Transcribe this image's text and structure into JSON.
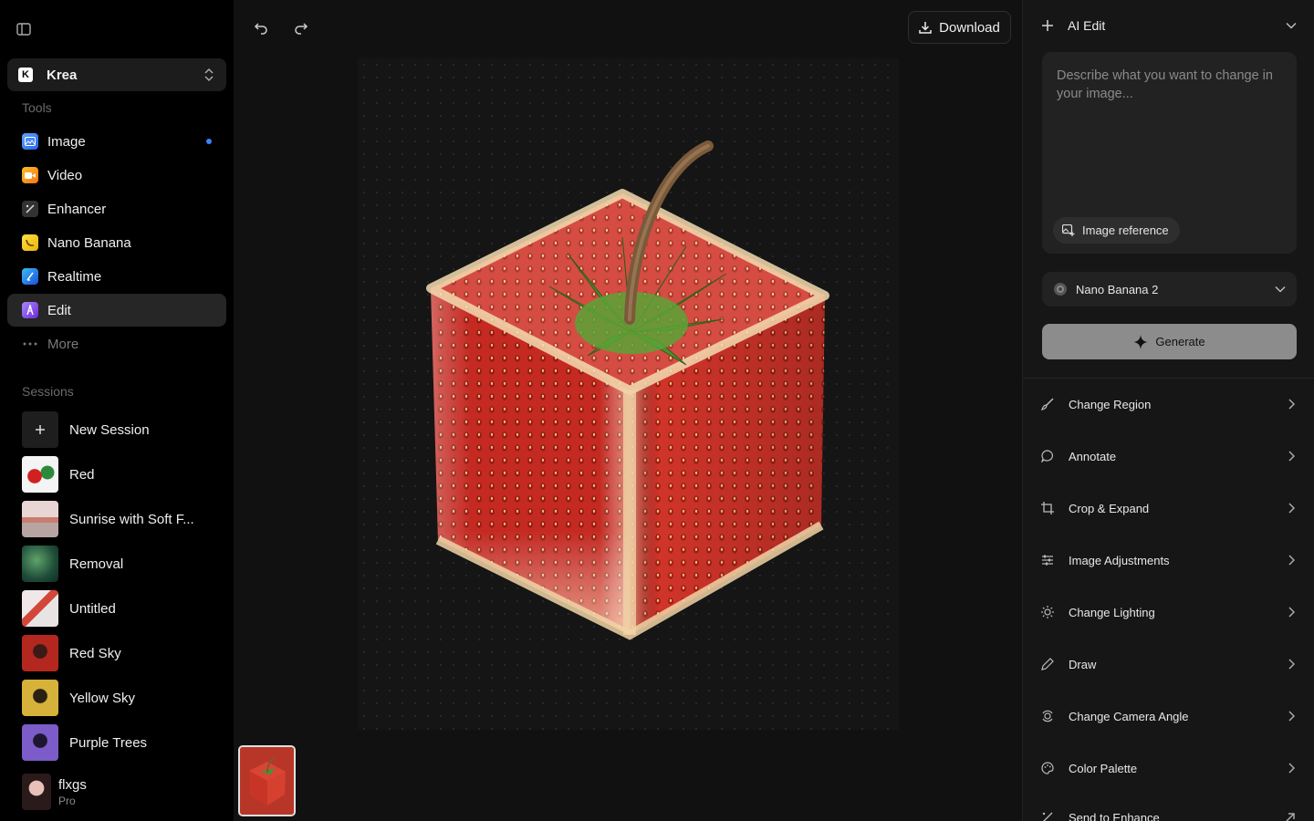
{
  "sidebar": {
    "workspace": {
      "logo": "K",
      "name": "Krea"
    },
    "tools_label": "Tools",
    "tools": [
      {
        "label": "Image",
        "icon": "image-app-icon",
        "color": "#3b82f6"
      },
      {
        "label": "Video",
        "icon": "video-app-icon",
        "color": "#f59e0b"
      },
      {
        "label": "Enhancer",
        "icon": "enhancer-app-icon",
        "color": "#3a3a3a"
      },
      {
        "label": "Nano Banana",
        "icon": "banana-app-icon",
        "color": "#facc15"
      },
      {
        "label": "Realtime",
        "icon": "realtime-app-icon",
        "color": "#3b82f6"
      },
      {
        "label": "Edit",
        "icon": "edit-app-icon",
        "color": "#7c3aed"
      },
      {
        "label": "More",
        "icon": "more-dots-icon"
      }
    ],
    "sessions_label": "Sessions",
    "new_session_label": "New Session",
    "sessions": [
      {
        "label": "Red"
      },
      {
        "label": "Sunrise with Soft F..."
      },
      {
        "label": "Removal"
      },
      {
        "label": "Untitled"
      },
      {
        "label": "Red Sky"
      },
      {
        "label": "Yellow Sky"
      },
      {
        "label": "Purple Trees"
      }
    ],
    "user": {
      "name": "flxgs",
      "plan": "Pro"
    }
  },
  "toolbar": {
    "download_label": "Download"
  },
  "panel": {
    "title": "AI Edit",
    "prompt_placeholder": "Describe what you want to change in your image...",
    "image_reference_label": "Image reference",
    "model": "Nano Banana 2",
    "generate_label": "Generate",
    "tools": [
      {
        "label": "Change Region",
        "icon": "brush-icon"
      },
      {
        "label": "Annotate",
        "icon": "speech-bubble-icon"
      },
      {
        "label": "Crop & Expand",
        "icon": "crop-icon"
      },
      {
        "label": "Image Adjustments",
        "icon": "sliders-icon"
      },
      {
        "label": "Change Lighting",
        "icon": "sun-icon"
      },
      {
        "label": "Draw",
        "icon": "pencil-icon"
      },
      {
        "label": "Change Camera Angle",
        "icon": "camera-angle-icon"
      },
      {
        "label": "Color Palette",
        "icon": "palette-icon"
      },
      {
        "label": "Send to Enhance",
        "icon": "enhance-icon"
      }
    ]
  }
}
